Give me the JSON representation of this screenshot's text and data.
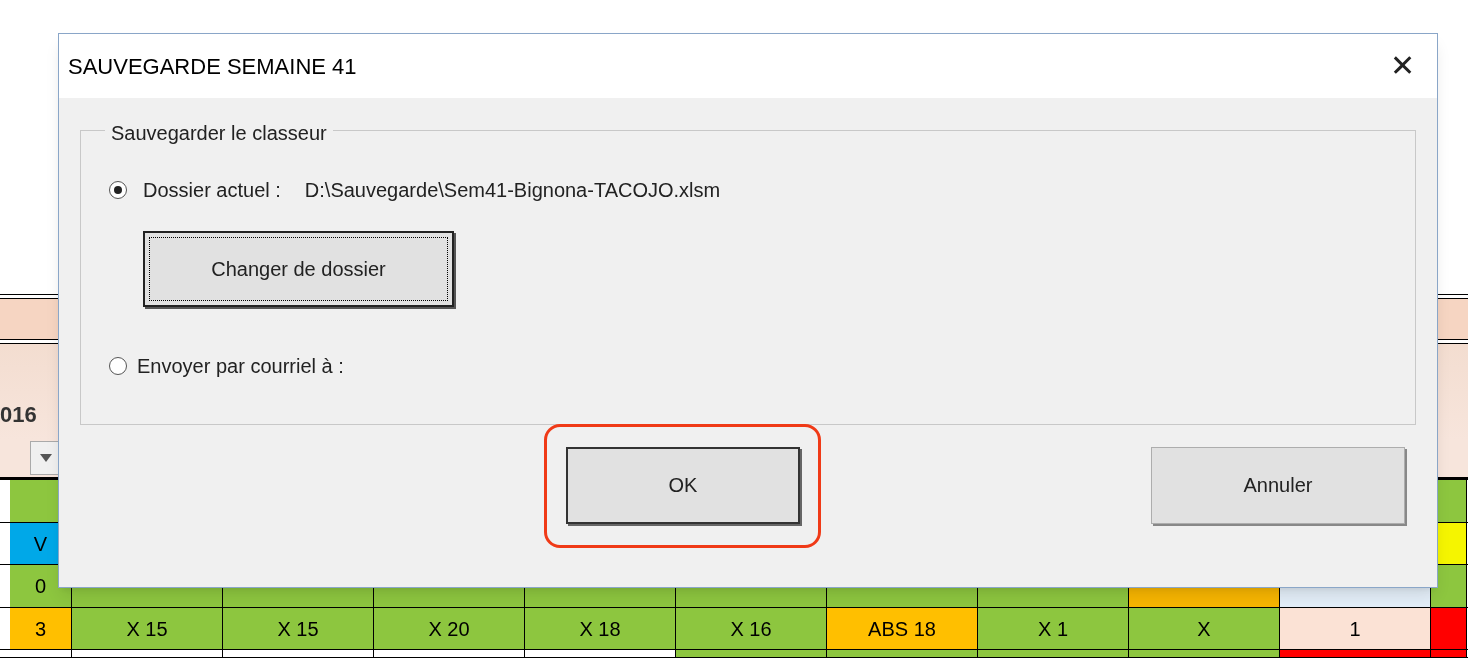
{
  "sheet": {
    "year_fragment": "016",
    "rows": [
      {
        "kind": "edges",
        "cells": [
          {
            "text": "",
            "color": "#8dc63f"
          },
          {
            "text": "",
            "color": "#8dc63f"
          }
        ]
      },
      {
        "kind": "edges",
        "cells": [
          {
            "text": "V",
            "color": "#00a8e8"
          },
          {
            "text": "",
            "color": "#f5f500"
          }
        ]
      },
      {
        "kind": "full",
        "cells": [
          {
            "text": "0",
            "color": "#8dc63f"
          },
          {
            "text": "",
            "color": "#8dc63f"
          },
          {
            "text": "",
            "color": "#8dc63f"
          },
          {
            "text": "",
            "color": "#8dc63f"
          },
          {
            "text": "",
            "color": "#8dc63f"
          },
          {
            "text": "",
            "color": "#8dc63f"
          },
          {
            "text": "",
            "color": "#8dc63f"
          },
          {
            "text": "",
            "color": "#8dc63f"
          },
          {
            "text": "",
            "color": "#f7b500"
          },
          {
            "text": "",
            "color": "#e3eef8"
          },
          {
            "text": "",
            "color": "#8dc63f"
          }
        ]
      },
      {
        "kind": "full",
        "cells": [
          {
            "text": "3",
            "color": "#ffbf00"
          },
          {
            "text": "X 15",
            "color": "#8dc63f"
          },
          {
            "text": "X 15",
            "color": "#8dc63f"
          },
          {
            "text": "X 20",
            "color": "#8dc63f"
          },
          {
            "text": "X 18",
            "color": "#8dc63f"
          },
          {
            "text": "X 16",
            "color": "#8dc63f"
          },
          {
            "text": "ABS 18",
            "color": "#ffbf00"
          },
          {
            "text": "X 1",
            "color": "#8dc63f"
          },
          {
            "text": "X",
            "color": "#8dc63f"
          },
          {
            "text": "1",
            "color": "#fbe2d5"
          },
          {
            "text": "",
            "color": "#ff0000"
          }
        ]
      },
      {
        "kind": "full",
        "cells": [
          {
            "text": "",
            "color": "#ffffff"
          },
          {
            "text": "",
            "color": "#ffffff"
          },
          {
            "text": "",
            "color": "#ffffff"
          },
          {
            "text": "",
            "color": "#ffffff"
          },
          {
            "text": "",
            "color": "#ffffff"
          },
          {
            "text": "",
            "color": "#8dc63f"
          },
          {
            "text": "",
            "color": "#8dc63f"
          },
          {
            "text": "",
            "color": "#8dc63f"
          },
          {
            "text": "",
            "color": "#8dc63f"
          },
          {
            "text": "",
            "color": "#ff0000"
          },
          {
            "text": "",
            "color": "#ff0000"
          }
        ]
      }
    ]
  },
  "dialog": {
    "title": "SAUVEGARDE SEMAINE 41",
    "close": "✕",
    "group_label": "Sauvegarder le classeur",
    "options": [
      {
        "label": "Dossier actuel :",
        "value": "D:\\Sauvegarde\\Sem41-Bignona-TACOJO.xlsm",
        "selected": true
      },
      {
        "label": "Envoyer par courriel à :",
        "selected": false
      }
    ],
    "change_folder_button": "Changer de dossier",
    "buttons": [
      {
        "label": "OK",
        "highlighted": true
      },
      {
        "label": "Annuler",
        "highlighted": false
      }
    ]
  }
}
